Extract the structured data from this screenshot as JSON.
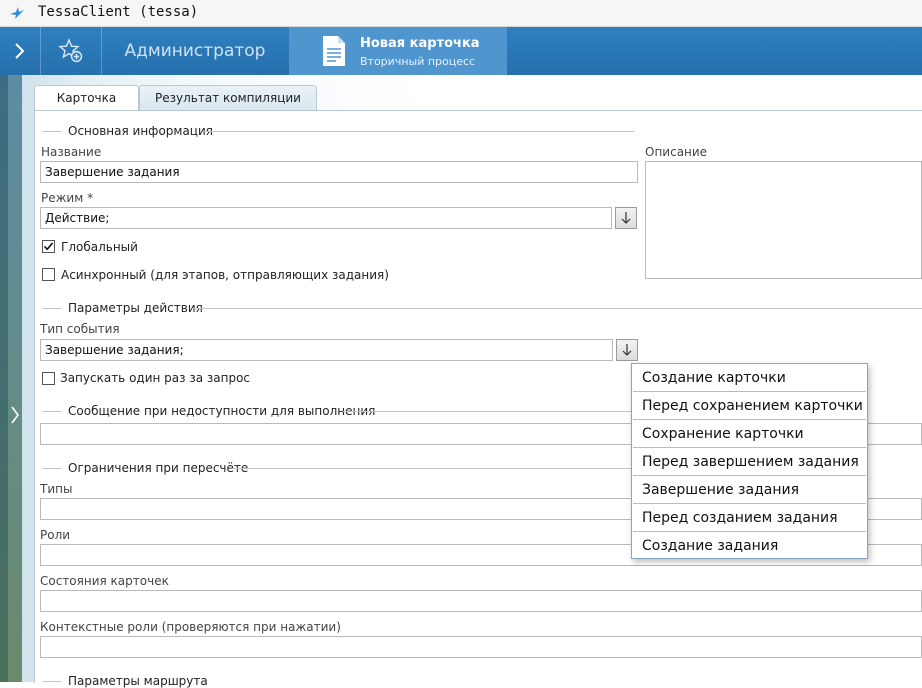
{
  "window": {
    "title": "TessaClient (tessa)"
  },
  "topbar": {
    "admin_tab_label": "Администратор",
    "card_tab": {
      "title": "Новая карточка",
      "subtitle": "Вторичный процесс"
    }
  },
  "tabs": [
    {
      "label": "Карточка",
      "active": true
    },
    {
      "label": "Результат компиляции",
      "active": false
    }
  ],
  "sections": {
    "main_info": {
      "title": "Основная информация",
      "name_label": "Название",
      "name_value": "Завершение задания",
      "mode_label": "Режим  *",
      "mode_value": "Действие;",
      "global_label": "Глобальный",
      "global_checked": true,
      "async_label": "Асинхронный (для этапов, отправляющих задания)",
      "async_checked": false,
      "description_label": "Описание",
      "description_value": ""
    },
    "action_params": {
      "title": "Параметры действия",
      "event_type_label": "Тип события",
      "event_type_value": "Завершение задания;",
      "run_once_label": "Запускать один раз за запрос",
      "run_once_checked": false
    },
    "unavailable_message": {
      "title": "Сообщение при недоступности для выполнения",
      "value": ""
    },
    "recalc_limits": {
      "title": "Ограничения при пересчёте",
      "types_label": "Типы",
      "roles_label": "Роли",
      "card_states_label": "Состояния карточек",
      "context_roles_label": "Контекстные роли (проверяются при нажатии)"
    },
    "route_params": {
      "title": "Параметры маршрута"
    }
  },
  "dropdown": {
    "items": [
      "Создание карточки",
      "Перед сохранением карточки",
      "Сохранение карточки",
      "Перед завершением задания",
      "Завершение задания",
      "Перед созданием задания",
      "Создание задания"
    ]
  },
  "colors": {
    "accent": "#2f7fc0",
    "active_tab": "#4f96cf"
  }
}
